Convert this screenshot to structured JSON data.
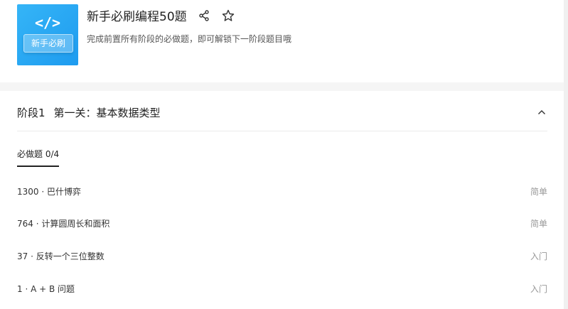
{
  "course": {
    "cover_code": "</>",
    "cover_label": "新手必刷",
    "title": "新手必刷编程50题",
    "subtitle": "完成前置所有阶段的必做题，即可解锁下一阶段题目哦",
    "share_icon": "share-icon",
    "star_icon": "star-icon"
  },
  "stage": {
    "label": "阶段1",
    "title": "第一关：基本数据类型",
    "collapse_icon": "chevron-up-icon"
  },
  "tab": {
    "label": "必做题 0/4"
  },
  "problems": [
    {
      "name": "1300 · 巴什博弈",
      "level": "简单"
    },
    {
      "name": "764 · 计算圆周长和面积",
      "level": "简单"
    },
    {
      "name": "37 · 反转一个三位整数",
      "level": "入门"
    },
    {
      "name": "1 · A + B 问题",
      "level": "入门"
    }
  ]
}
